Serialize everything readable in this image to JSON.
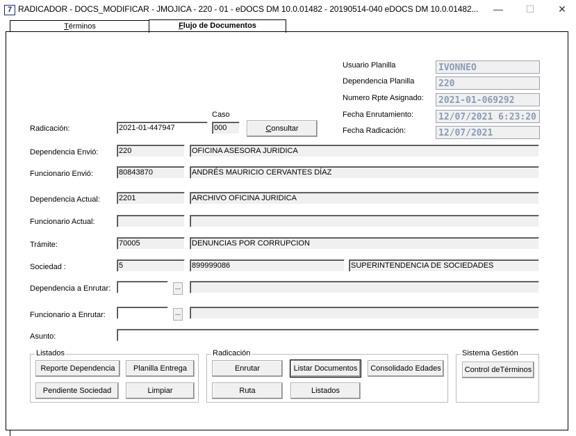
{
  "window": {
    "title": "RADICADOR - DOCS_MODIFICAR - JMOJICA - 220 - 01 - eDOCS DM 10.0.01482 - 20190514-040 eDOCS DM 10.0.01482...",
    "app_icon": "7",
    "minimize": "—",
    "maximize": "☐",
    "close": "✕"
  },
  "tabs": [
    {
      "label_prefix": "",
      "label_u": "T",
      "label_rest": "érminos"
    },
    {
      "label_prefix": "",
      "label_u": "F",
      "label_rest": "lujo de Documentos"
    }
  ],
  "planilla": {
    "usuario_label": "Usuario Planilla",
    "usuario_value": "IVONNEO",
    "dependencia_label": "Dependencia Planilla",
    "dependencia_value": "220",
    "numero_label": "Numero Rpte Asignado:",
    "numero_value": "2021-01-069292",
    "fecha_enrut_label": "Fecha Enrutamiento:",
    "fecha_enrut_value": "12/07/2021 6:23:20",
    "fecha_rad_label": "Fecha Radicación:",
    "fecha_rad_value": "12/07/2021"
  },
  "form": {
    "radicacion_label": "Radicación:",
    "radicacion_value": "2021-01-447947",
    "caso_label": "Caso",
    "caso_value": "000",
    "consultar_u": "C",
    "consultar_rest": "onsultar",
    "dep_envio_label": "Dependencia Envió:",
    "dep_envio_code": "220",
    "dep_envio_name": "OFICINA  ASESORA JURIDICA",
    "func_envio_label": "Funcionario Envió:",
    "func_envio_code": "80843870",
    "func_envio_name": "ANDRÉS MAURICIO CERVANTES DÍAZ",
    "dep_actual_label": "Dependencia Actual:",
    "dep_actual_code": "2201",
    "dep_actual_name": "ARCHIVO OFICINA JURIDICA",
    "func_actual_label": "Funcionario Actual:",
    "func_actual_code": "",
    "func_actual_name": "",
    "tramite_label": "Trámite:",
    "tramite_code": "70005",
    "tramite_name": "DENUNCIAS POR CORRUPCION",
    "sociedad_label": "Sociedad :",
    "sociedad_code": "5",
    "sociedad_nit": "899999086",
    "sociedad_name": "SUPERINTENDENCIA DE SOCIEDADES",
    "dep_enrutar_label": "Dependencia a Enrutar:",
    "func_enrutar_label": "Funcionario a Enrutar:",
    "asunto_label": "Asunto:",
    "browse": "..."
  },
  "listados_group": {
    "title": "Listados",
    "reporte_dependencia": "Reporte Dependencia",
    "planilla_entrega": "Planilla Entrega",
    "pendiente_sociedad": "Pendiente Sociedad",
    "limpiar": "Limpiar"
  },
  "radicacion_group": {
    "title": "Radicación",
    "enrutar": "Enrutar",
    "listar_documentos": "Listar Documentos",
    "consolidado_edades": "Consolidado Edades",
    "ruta": "Ruta",
    "listados": "Listados"
  },
  "sistema_group": {
    "title": "Sistema Gestión",
    "control_terminos": "Control deTérminos"
  }
}
